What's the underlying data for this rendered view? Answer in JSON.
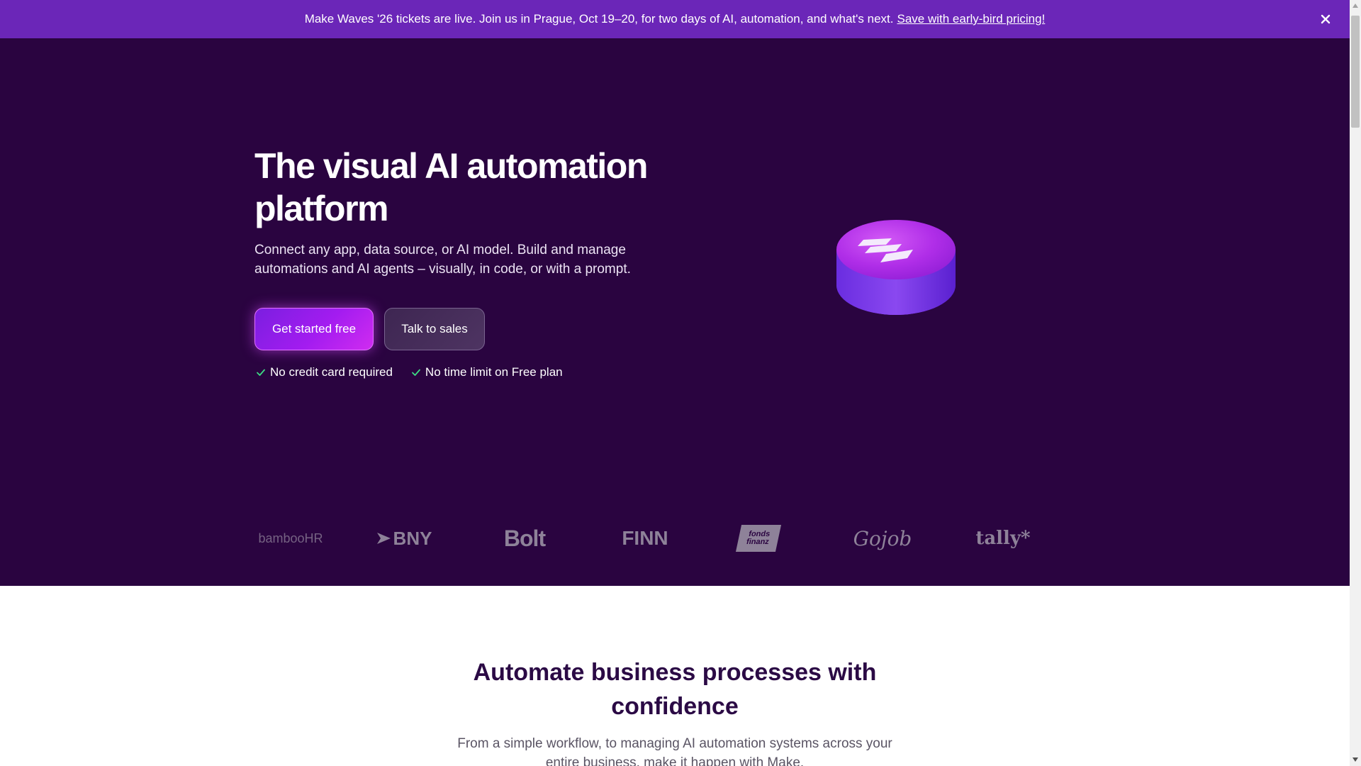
{
  "announcement": {
    "message": "Make Waves '26 tickets are live. Join us in Prague, Oct 19–20, for two days of AI, automation, and what's next.",
    "link_text": "Save with early-bird pricing!",
    "close_icon": "close-icon"
  },
  "hero": {
    "title": "The visual AI automation platform",
    "subtitle": "Connect any app, data source, or AI model. Build and manage automations and AI agents – visually, in code, or with a prompt.",
    "primary_button": "Get started free",
    "secondary_button": "Talk to sales",
    "checks": [
      {
        "icon": "check-icon",
        "label": "No credit card required"
      },
      {
        "icon": "check-icon",
        "label": "No time limit on Free plan"
      }
    ],
    "illustration_icon": "make-logo-disc-icon"
  },
  "logos": [
    {
      "name": "bamboohr",
      "text": "bambooHR"
    },
    {
      "name": "bny",
      "text": "BNY"
    },
    {
      "name": "bolt",
      "text": "Bolt"
    },
    {
      "name": "finn",
      "text": "FINN"
    },
    {
      "name": "fonds-finanz",
      "text": "fonds finanz"
    },
    {
      "name": "gojob",
      "text": "Gojob"
    },
    {
      "name": "tally",
      "text": "tally*"
    }
  ],
  "section2": {
    "title": "Automate business processes with confidence",
    "subtitle": "From a simple workflow, to managing AI automation systems across your entire business, make it happen with Make."
  },
  "colors": {
    "announcement_bg": "#6b26b8",
    "hero_bg": "#2a0440",
    "accent_purple": "#a31cf0",
    "check_green": "#3ddc84",
    "heading_dark": "#2b0a45"
  }
}
